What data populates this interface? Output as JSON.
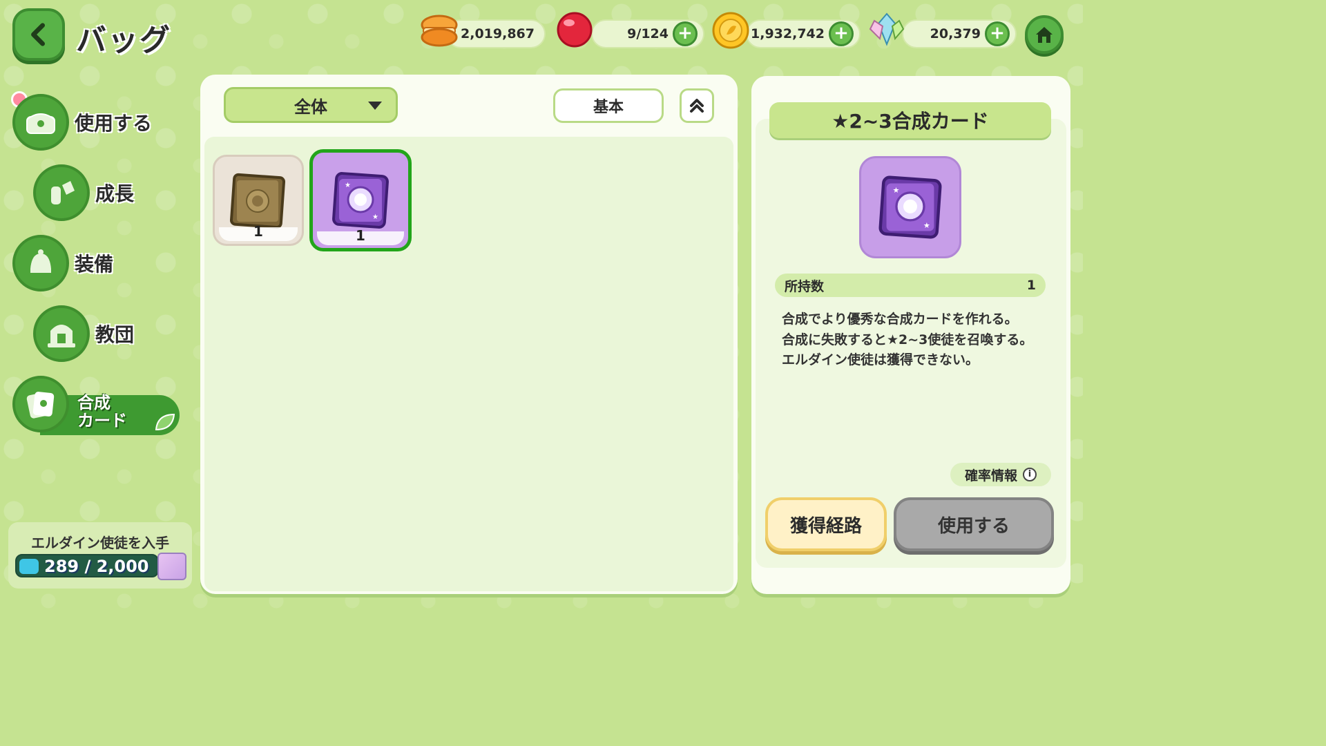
{
  "header": {
    "title": "バッグ",
    "currencies": [
      {
        "icon": "macaron-icon",
        "value": "2,019,867"
      },
      {
        "icon": "candy-icon",
        "value": "9/124"
      },
      {
        "icon": "gold-coin-icon",
        "value": "1,932,742"
      },
      {
        "icon": "crystal-icon",
        "value": "20,379"
      }
    ]
  },
  "sidebar": {
    "items": [
      {
        "label": "使用する",
        "icon": "chest-icon"
      },
      {
        "label": "成長",
        "icon": "potion-icon"
      },
      {
        "label": "装備",
        "icon": "equipment-icon"
      },
      {
        "label": "教団",
        "icon": "temple-icon"
      },
      {
        "label_line1": "合成",
        "label_line2": "カード",
        "icon": "card-icon",
        "active": true
      }
    ],
    "progress": {
      "title": "エルダイン使徒を入手",
      "text": "289 / 2,000",
      "current": 289,
      "max": 2000
    }
  },
  "inventory": {
    "filter": "全体",
    "sort": "基本",
    "items": [
      {
        "name": "bronze-card",
        "count": "1",
        "selected": false
      },
      {
        "name": "purple-card",
        "count": "1",
        "selected": true
      }
    ]
  },
  "detail": {
    "title": "★2~3合成カード",
    "owned_label": "所持数",
    "owned_value": "1",
    "description": "合成でより優秀な合成カードを作れる。\n合成に失敗すると★2~3使徒を召喚する。\nエルダイン使徒は獲得できない。",
    "prob_label": "確率情報",
    "info_icon": "i",
    "acquire_label": "獲得経路",
    "use_label": "使用する"
  },
  "colors": {
    "background": "#c5e391",
    "accent_green": "#4ea53a",
    "selected_border": "#22a51a",
    "card_purple": "#c79ee8"
  }
}
